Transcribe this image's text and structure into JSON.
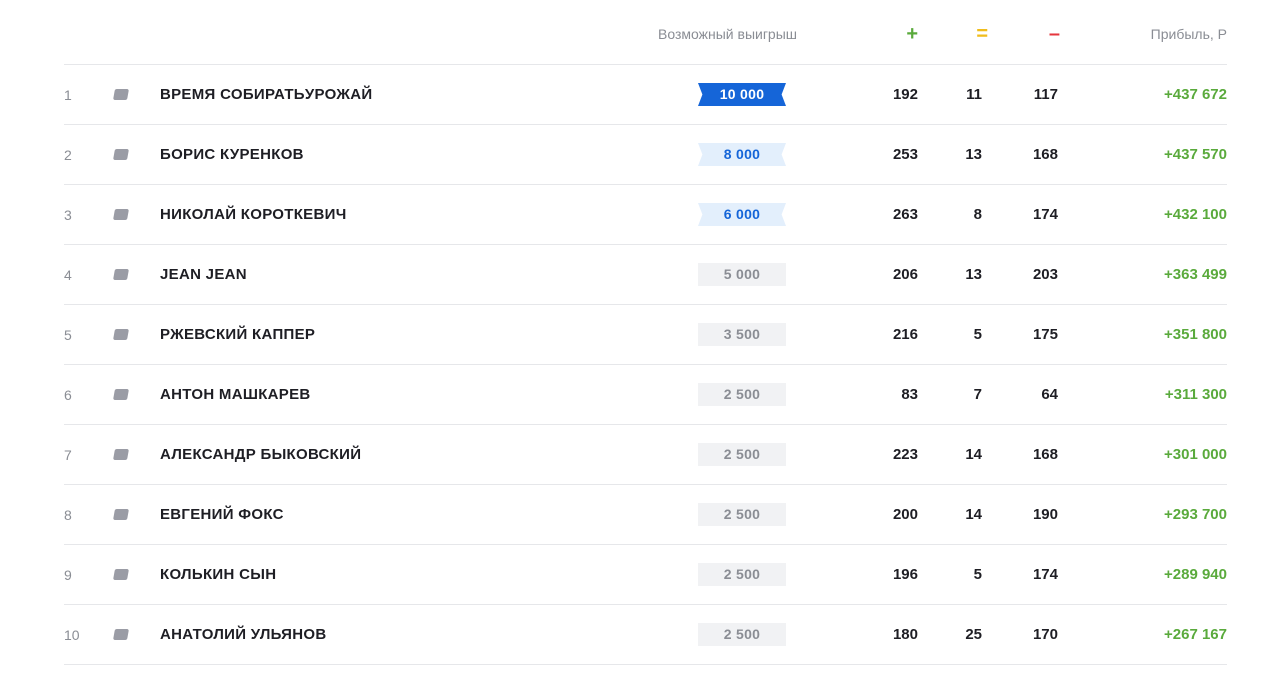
{
  "header": {
    "prize_label": "Возможный выигрыш",
    "wins_label": "+",
    "draws_label": "=",
    "losses_label": "–",
    "profit_label": "Прибыль, Р"
  },
  "colors": {
    "accent_blue": "#1565d8",
    "light_blue": "#e3effc",
    "profit_green": "#5aaa3c",
    "draw_yellow": "#f0bd1c",
    "loss_red": "#e5363d"
  },
  "icons": {
    "flag": "flag-icon"
  },
  "rows": [
    {
      "rank": "1",
      "name": "ВРЕМЯ СОБИРАТЬУРОЖАЙ",
      "prize": "10 000",
      "tier": "gold",
      "wins": "192",
      "draws": "11",
      "losses": "117",
      "profit": "+437 672"
    },
    {
      "rank": "2",
      "name": "БОРИС КУРЕНКОВ",
      "prize": "8 000",
      "tier": "silver",
      "wins": "253",
      "draws": "13",
      "losses": "168",
      "profit": "+437 570"
    },
    {
      "rank": "3",
      "name": "НИКОЛАЙ КОРОТКЕВИЧ",
      "prize": "6 000",
      "tier": "silver",
      "wins": "263",
      "draws": "8",
      "losses": "174",
      "profit": "+432 100"
    },
    {
      "rank": "4",
      "name": "JEAN JEAN",
      "prize": "5 000",
      "tier": "plain",
      "wins": "206",
      "draws": "13",
      "losses": "203",
      "profit": "+363 499"
    },
    {
      "rank": "5",
      "name": "РЖЕВСКИЙ КАППЕР",
      "prize": "3 500",
      "tier": "plain",
      "wins": "216",
      "draws": "5",
      "losses": "175",
      "profit": "+351 800"
    },
    {
      "rank": "6",
      "name": "АНТОН МАШКАРЕВ",
      "prize": "2 500",
      "tier": "plain",
      "wins": "83",
      "draws": "7",
      "losses": "64",
      "profit": "+311 300"
    },
    {
      "rank": "7",
      "name": "АЛЕКСАНДР БЫКОВСКИЙ",
      "prize": "2 500",
      "tier": "plain",
      "wins": "223",
      "draws": "14",
      "losses": "168",
      "profit": "+301 000"
    },
    {
      "rank": "8",
      "name": "ЕВГЕНИЙ ФОКС",
      "prize": "2 500",
      "tier": "plain",
      "wins": "200",
      "draws": "14",
      "losses": "190",
      "profit": "+293 700"
    },
    {
      "rank": "9",
      "name": "КОЛЬКИН СЫН",
      "prize": "2 500",
      "tier": "plain",
      "wins": "196",
      "draws": "5",
      "losses": "174",
      "profit": "+289 940"
    },
    {
      "rank": "10",
      "name": "АНАТОЛИЙ УЛЬЯНОВ",
      "prize": "2 500",
      "tier": "plain",
      "wins": "180",
      "draws": "25",
      "losses": "170",
      "profit": "+267 167"
    }
  ]
}
